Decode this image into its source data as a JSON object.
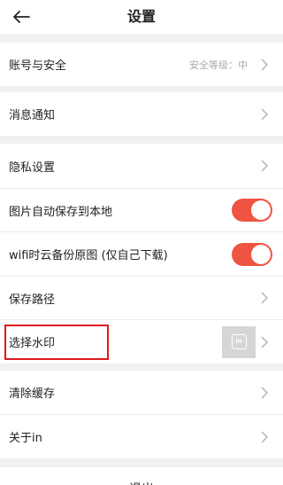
{
  "header": {
    "title": "设置",
    "back_icon": "arrow-left-icon"
  },
  "sections": [
    {
      "items": [
        {
          "id": "account-security",
          "label": "账号与安全",
          "hint": "安全等级：中",
          "chevron": true
        }
      ]
    },
    {
      "items": [
        {
          "id": "notifications",
          "label": "消息通知",
          "chevron": true
        }
      ]
    },
    {
      "items": [
        {
          "id": "privacy",
          "label": "隐私设置",
          "chevron": true
        },
        {
          "id": "auto-save-images",
          "label": "图片自动保存到本地",
          "toggle": "on"
        },
        {
          "id": "wifi-backup",
          "label": "wifi时云备份原图 (仅自己下载)",
          "toggle": "on"
        },
        {
          "id": "save-path",
          "label": "保存路径",
          "chevron": true
        },
        {
          "id": "watermark",
          "label": "选择水印",
          "thumbnail": "in",
          "chevron": true,
          "highlighted": true
        }
      ]
    },
    {
      "items": [
        {
          "id": "clear-cache",
          "label": "清除缓存",
          "chevron": true
        },
        {
          "id": "about",
          "label": "关于in",
          "chevron": true
        }
      ]
    }
  ],
  "footer": {
    "logout_label": "退出"
  },
  "colors": {
    "toggle_on": "#ee5441",
    "highlight_border": "#e0191b",
    "background": "#f1f1f3"
  }
}
